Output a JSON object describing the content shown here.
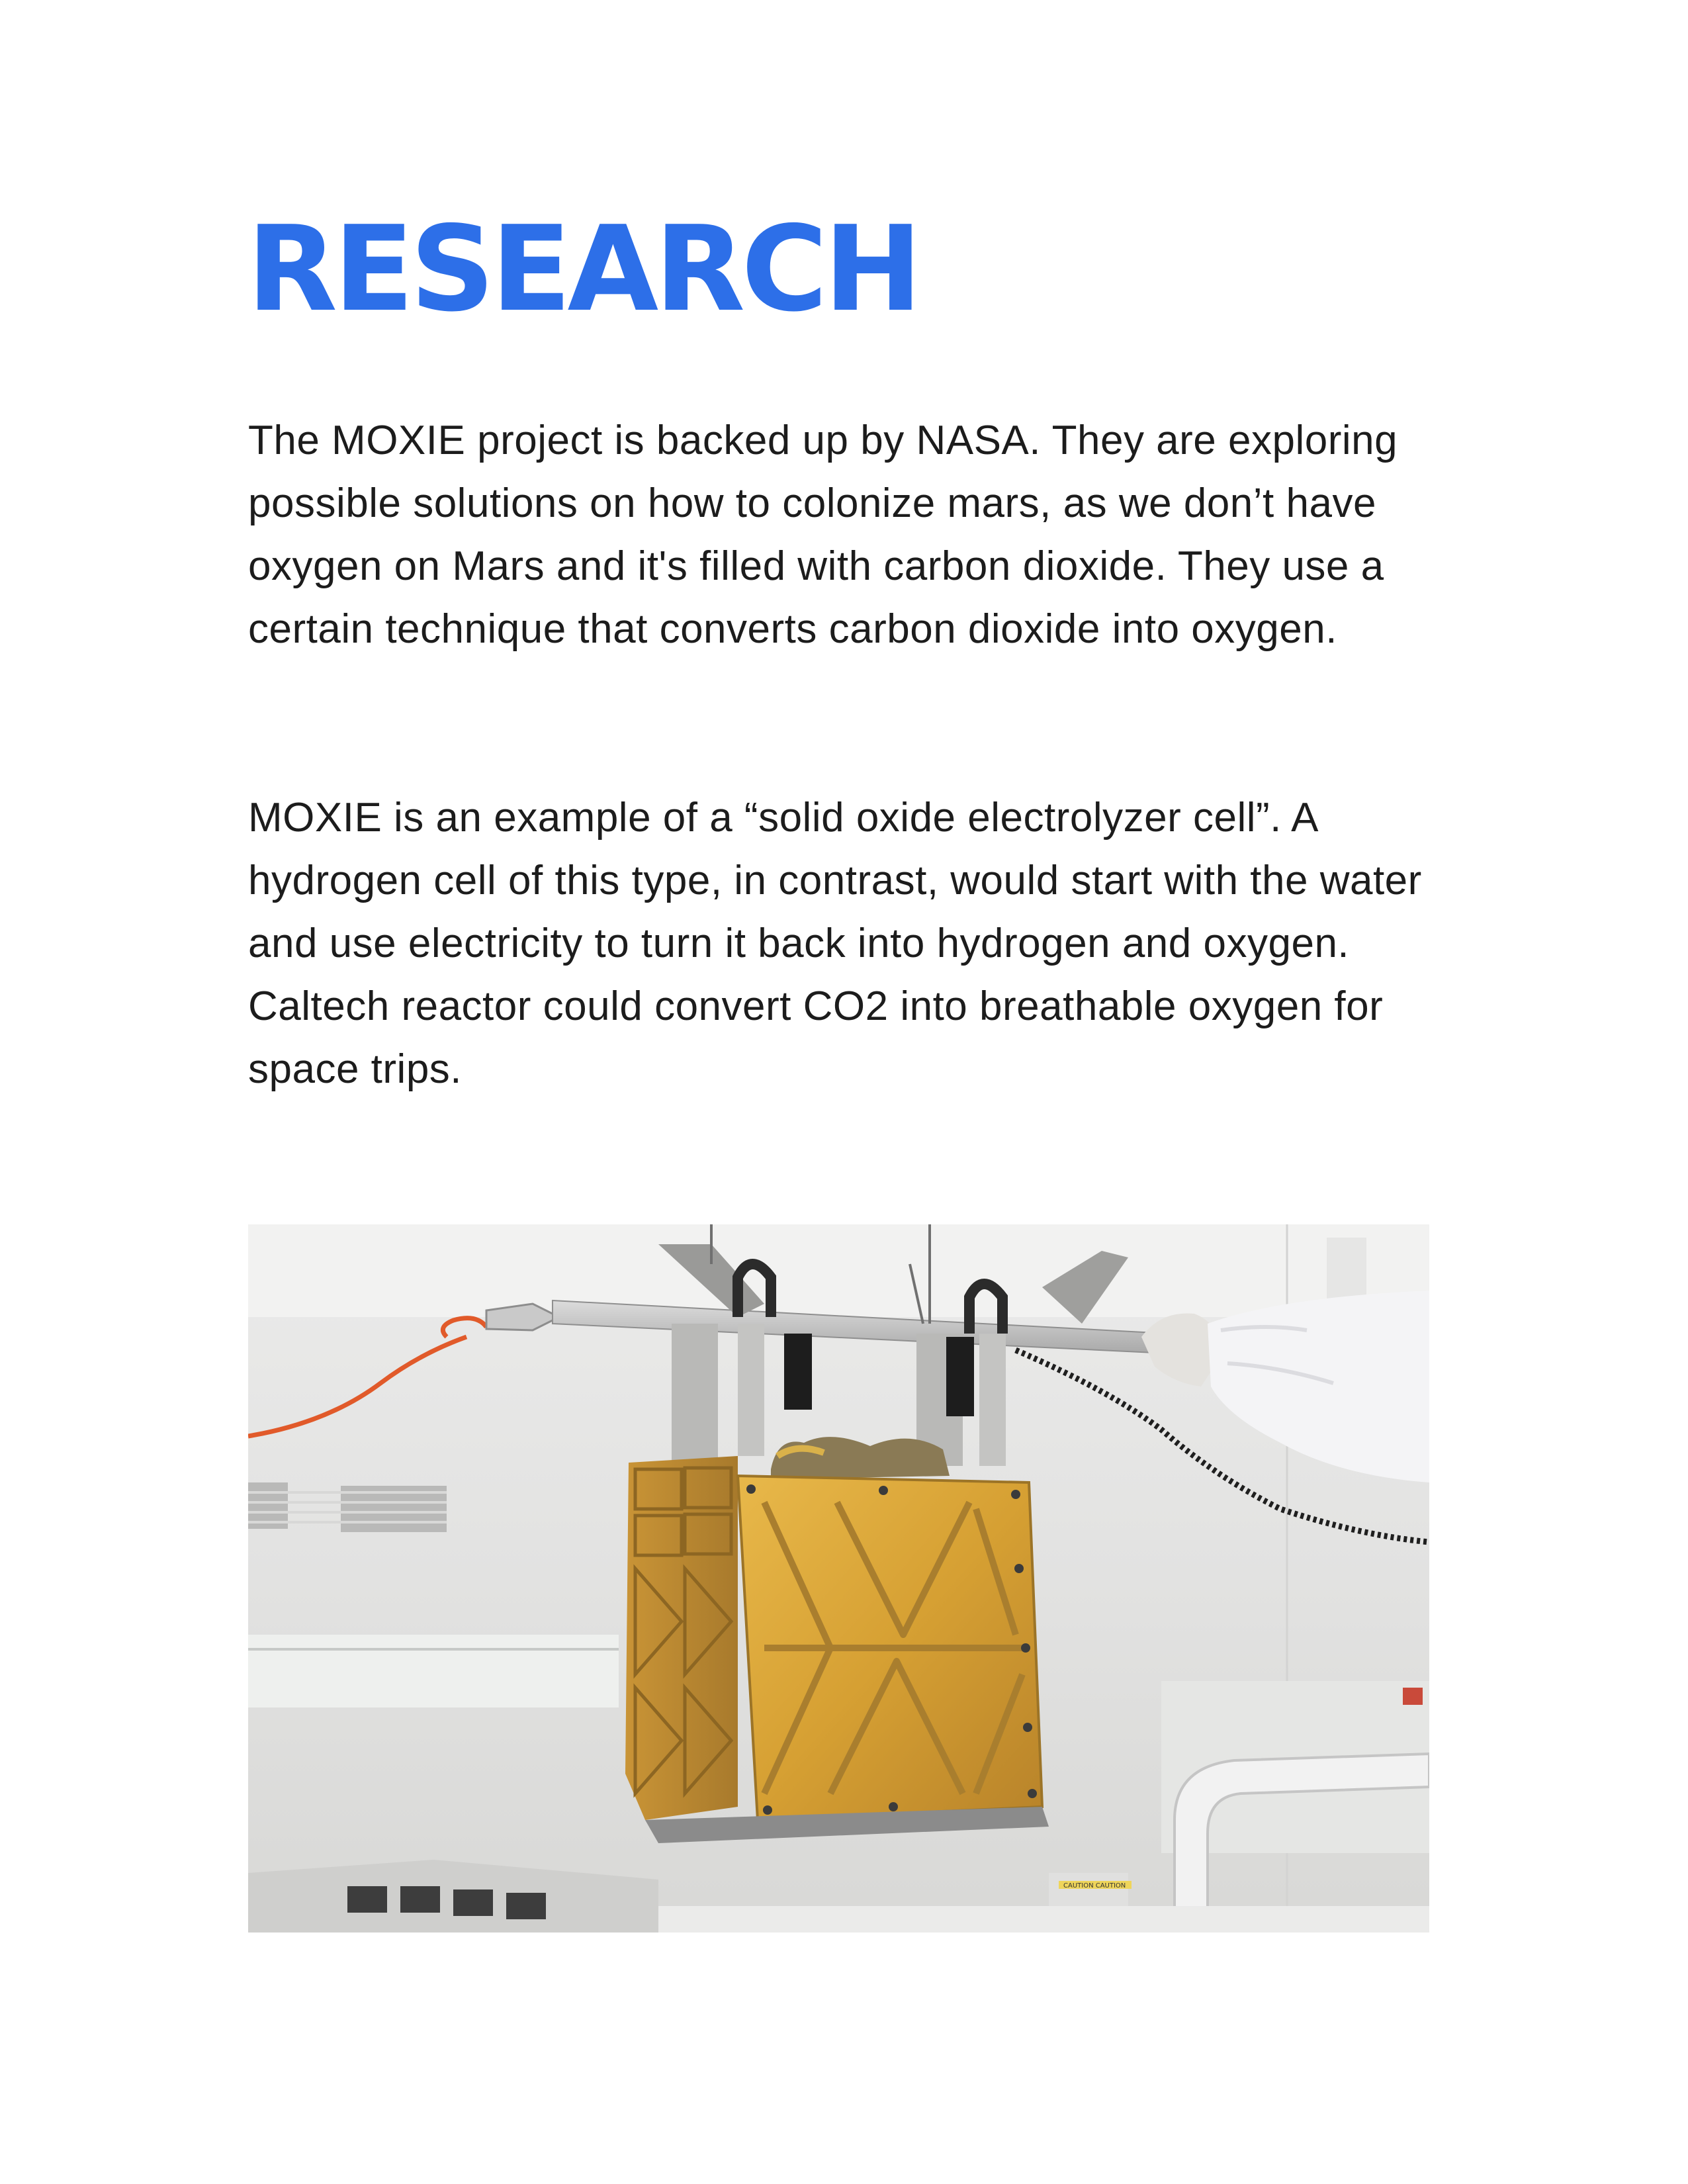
{
  "page": {
    "title": "RESEARCH",
    "paragraph_1": "The MOXIE project is backed up by NASA. They are exploring possible solutions on how to colonize mars, as we don’t have oxygen on Mars and it's filled with carbon dioxide. They use a certain technique that converts carbon dioxide into oxygen.",
    "paragraph_2": "MOXIE is an example of a “solid oxide electrolyzer cell”. A hydrogen cell of this type, in contrast, would start with the water and use electricity to turn it back into hydrogen and oxygen. Caltech reactor could convert CO2 into breathable oxygen for space trips."
  },
  "photo": {
    "caution_tape_text": "CAUTION CAUTION",
    "title_color": "#2d6fe8"
  }
}
